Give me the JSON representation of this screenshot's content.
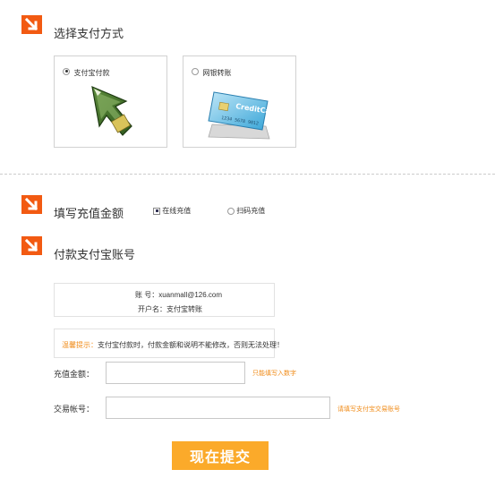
{
  "colors": {
    "accent_orange": "#f25a12",
    "button_orange": "#fbaa2a",
    "hint_orange": "#f08c1a"
  },
  "sections": {
    "choose_method": {
      "title": "选择支付方式",
      "icon": "arrow-down-right-icon"
    },
    "recharge_amount": {
      "title": "填写充值金额",
      "icon": "arrow-down-right-icon"
    },
    "payer_account": {
      "title": "付款支付宝账号",
      "icon": "arrow-down-right-icon"
    }
  },
  "payment_methods": [
    {
      "label": "支付宝付款",
      "selected": true,
      "icon": "alipay-arrow-icon"
    },
    {
      "label": "网银转账",
      "selected": false,
      "icon": "credit-card-icon"
    }
  ],
  "card_art_text": {
    "brand": "CreditCard",
    "number": "1234 5678 9012"
  },
  "recharge_options": [
    {
      "label": "在线充值",
      "selected": true
    },
    {
      "label": "扫码充值",
      "selected": false
    }
  ],
  "account_info": {
    "account_line": "账    号：xuanmall@126.com",
    "holder_line": "开户名：支付宝转账"
  },
  "tip": {
    "label": "温馨提示：",
    "text": "支付宝付款时，付款金额和说明不能修改，否则无法处理！"
  },
  "form": {
    "amount_label": "充值金额：",
    "amount_value": "",
    "amount_hint": "只能填写入数字",
    "account_label": "交易帐号：",
    "account_value": "",
    "account_hint": "请填写支付宝交易账号"
  },
  "submit_label": "现在提交"
}
